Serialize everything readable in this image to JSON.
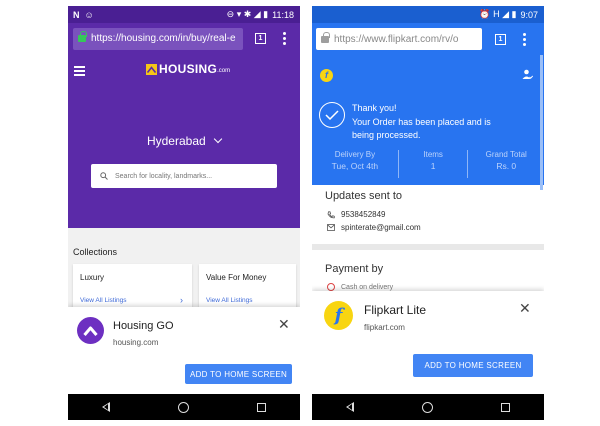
{
  "left": {
    "status_time": "11:18",
    "status_left_icons": [
      "N",
      "☺"
    ],
    "url": "https://housing.com/in/buy/real-e",
    "tab_count": "1",
    "logo_text": "HOUSING",
    "logo_suffix": ".com",
    "city": "Hyderabad",
    "search_placeholder": "Search for locality, landmarks...",
    "section_title": "Collections",
    "cards": [
      {
        "title": "Luxury",
        "link": "View All Listings"
      },
      {
        "title": "Value For Money",
        "link": "View All Listings"
      }
    ],
    "banner": {
      "app_name": "Housing GO",
      "domain": "housing.com",
      "button": "ADD TO HOME SCREEN"
    },
    "colors": {
      "brand": "#5b2aa8",
      "statusbar": "#4a1f93",
      "accent": "#f5c518"
    }
  },
  "right": {
    "status_time": "9:07",
    "url": "https://www.flipkart.com/rv/o",
    "tab_count": "1",
    "thank_you": "Thank you!",
    "order_message": "Your Order has been placed and is being processed.",
    "summary": [
      {
        "label": "Delivery By",
        "value": "Tue, Oct 4th"
      },
      {
        "label": "Items",
        "value": "1"
      },
      {
        "label": "Grand Total",
        "value": "Rs. 0"
      }
    ],
    "updates_title": "Updates sent to",
    "phone": "9538452849",
    "email": "spinterate@gmail.com",
    "payment_title": "Payment by",
    "payment_method": "Cash on delivery",
    "banner": {
      "app_name": "Flipkart Lite",
      "domain": "flipkart.com",
      "button": "ADD TO HOME SCREEN"
    },
    "colors": {
      "brand": "#2874f0",
      "statusbar": "#1a5fd0",
      "accent": "#f8d511"
    }
  }
}
